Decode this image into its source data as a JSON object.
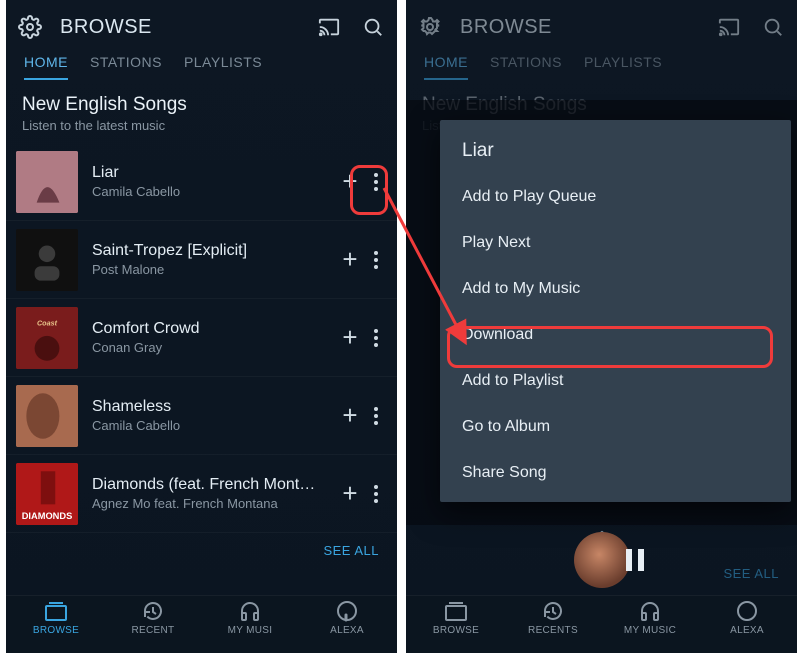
{
  "header": {
    "title": "BROWSE"
  },
  "tabs": [
    "HOME",
    "STATIONS",
    "PLAYLISTS"
  ],
  "active_tab": 0,
  "section": {
    "heading": "New English Songs",
    "subheading": "Listen to the latest music"
  },
  "tracks": [
    {
      "title": "Liar",
      "artist": "Camila Cabello",
      "thumb_bg": "#b07b84",
      "thumb_text": ""
    },
    {
      "title": "Saint-Tropez [Explicit]",
      "artist": "Post Malone",
      "thumb_bg": "#121212",
      "thumb_text": ""
    },
    {
      "title": "Comfort Crowd",
      "artist": "Conan Gray",
      "thumb_bg": "#7a1c1c",
      "thumb_text": ""
    },
    {
      "title": "Shameless",
      "artist": "Camila Cabello",
      "thumb_bg": "#a86a4f",
      "thumb_text": ""
    },
    {
      "title": "Diamonds (feat. French Mont…",
      "artist": "Agnez Mo feat. French Montana",
      "thumb_bg": "#b01818",
      "thumb_text": "DIAMONDS"
    }
  ],
  "see_all": "SEE ALL",
  "bottom_nav": {
    "items": [
      "BROWSE",
      "RECENTS",
      "MY MUSIC",
      "ALEXA"
    ],
    "display": [
      "BROWSE",
      "RECENT",
      "MY MUSI",
      "ALEXA"
    ],
    "active": 0
  },
  "context_menu": {
    "track_title": "Liar",
    "items": [
      "Add to Play Queue",
      "Play Next",
      "Add to My Music",
      "Download",
      "Add to Playlist",
      "Go to Album",
      "Share Song"
    ],
    "highlight_index": 3
  },
  "colors": {
    "accent": "#3aa5e0",
    "annotation": "#ef3b3b",
    "sheet_bg": "#33414f"
  }
}
